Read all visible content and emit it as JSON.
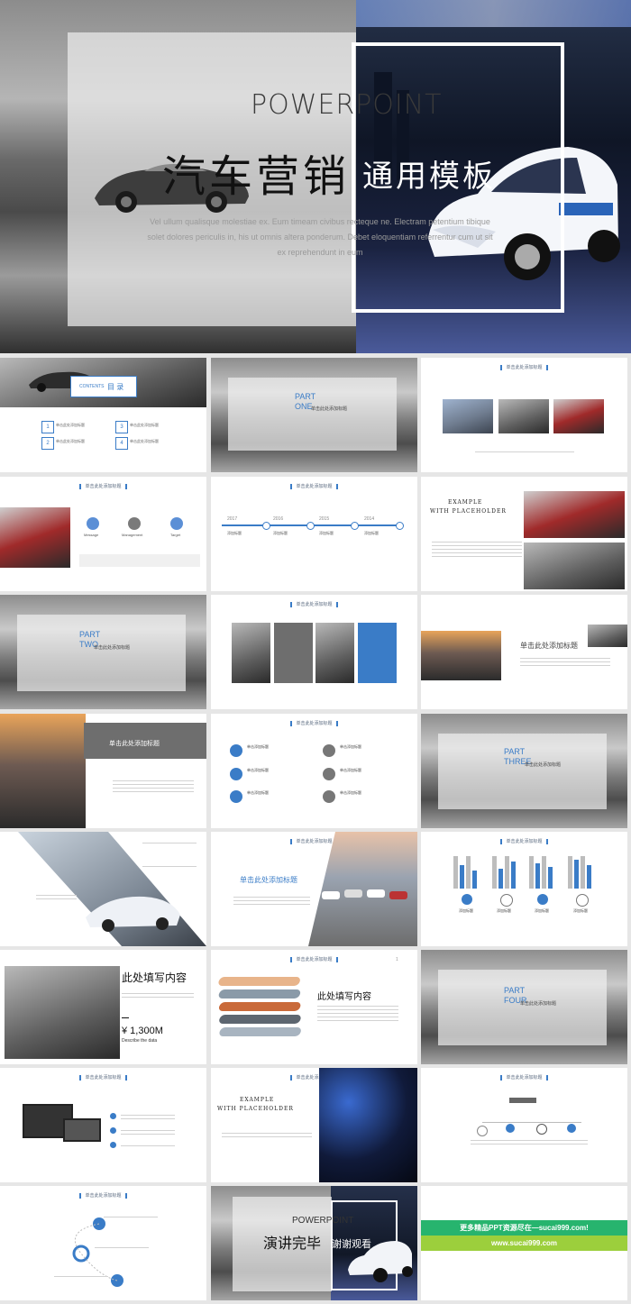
{
  "hero": {
    "brand": "POWERPOINT",
    "title": "汽车营销",
    "subtitle": "通用模板",
    "desc": "Vel ullum qualisque molestiae ex. Eum timeam civibus recteque ne. Electram petentium tibique solet dolores periculis in, his ut omnis altera ponderum. Debet eloquentiam referrentur cum ut sit ex reprehendunt in eum"
  },
  "s1": {
    "contents": "CONTENTS",
    "mulu": "目 录",
    "items": [
      {
        "n": "1",
        "t": "单击此处添加标题"
      },
      {
        "n": "3",
        "t": "单击此处添加标题"
      },
      {
        "n": "2",
        "t": "单击此处添加标题"
      },
      {
        "n": "4",
        "t": "单击此处添加标题"
      }
    ]
  },
  "part_one": {
    "part": "PART",
    "num": "ONE",
    "sub": "单击此处添加标题"
  },
  "part_two": {
    "part": "PART",
    "num": "TWO",
    "sub": "单击此处添加标题"
  },
  "part_three": {
    "part": "PART",
    "num": "THREE",
    "sub": "单击此处添加标题"
  },
  "part_four": {
    "part": "PART",
    "num": "FOUR",
    "sub": "单击此处添加标题"
  },
  "slide_header": "单击此处添加标题",
  "s4": {
    "labels": [
      "Message",
      "Management",
      "Target"
    ]
  },
  "s5": {
    "years": [
      "2017",
      "2016",
      "2015",
      "2014"
    ],
    "item": "添加标题"
  },
  "s6": {
    "title1": "EXAMPLE",
    "title2": "WITH PLACEHOLDER"
  },
  "s9": {
    "title": "单击此处添加标题"
  },
  "s10": {
    "title": "单击此处添加标题"
  },
  "s11": {
    "items": [
      "单击添加标题",
      "单击添加标题",
      "单击添加标题",
      "单击添加标题",
      "单击添加标题",
      "单击添加标题"
    ]
  },
  "s14": {
    "title": "单击此处添加标题"
  },
  "s15": {
    "labels": [
      "添加标题",
      "添加标题",
      "添加标题",
      "添加标题"
    ]
  },
  "s16": {
    "title": "此处填写内容",
    "price": "¥ 1,300M",
    "caption": "Describe the data"
  },
  "s17": {
    "title": "此处填写内容",
    "page": "1"
  },
  "s20": {
    "title1": "EXAMPLE",
    "title2": "WITH PLACEHOLDER"
  },
  "end": {
    "brand": "POWERPOINT",
    "title": "演讲完毕",
    "sub": "谢谢观看"
  },
  "ad": {
    "line1": "更多精品PPT资源尽在—sucai999.com!",
    "line2": "www.sucai999.com"
  },
  "colors": {
    "accent": "#3a7cc7",
    "ad_green": "#27b46e",
    "ad_lime": "#9ccf3c"
  }
}
